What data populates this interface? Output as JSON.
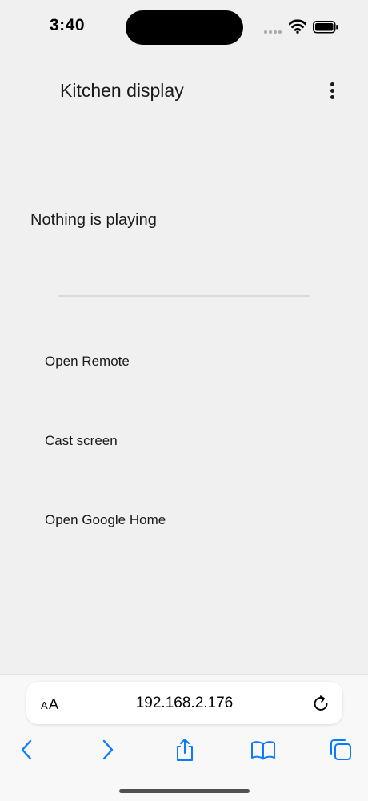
{
  "status_bar": {
    "time": "3:40",
    "icons": [
      "cellular-signal-icon",
      "wifi-icon",
      "battery-icon"
    ]
  },
  "header": {
    "title": "Kitchen display",
    "menu_icon": "more-vertical-icon"
  },
  "player": {
    "status": "Nothing is playing"
  },
  "actions": [
    {
      "label": "Open Remote"
    },
    {
      "label": "Cast screen"
    },
    {
      "label": "Open Google Home"
    }
  ],
  "browser": {
    "text_size_label_small": "A",
    "text_size_label_large": "A",
    "url": "192.168.2.176",
    "toolbar": [
      "back-icon",
      "forward-icon",
      "share-icon",
      "bookmarks-icon",
      "tabs-icon"
    ],
    "accent_color": "#0a7aff"
  }
}
